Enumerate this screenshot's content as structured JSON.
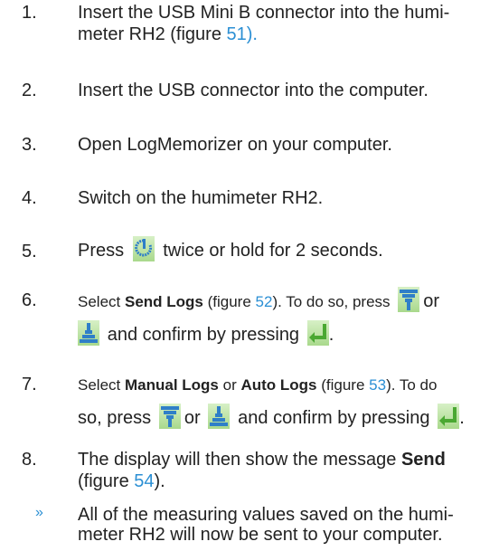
{
  "steps": [
    {
      "num": "1.",
      "text": "Insert the USB Mini B connector into the humi-",
      "text2": "meter RH2 (figure ",
      "fig": "51)."
    },
    {
      "num": "2.",
      "text": "Insert the USB connector into the computer."
    },
    {
      "num": "3.",
      "text": "Open LogMemorizer on your computer."
    },
    {
      "num": "4.",
      "text": "Switch on the humimeter RH2."
    },
    {
      "num": "5.",
      "pre": "Press",
      "post": "twice or hold for 2 seconds."
    },
    {
      "num": "6.",
      "a": "Select ",
      "bold": "Send Logs",
      "b": " (figure ",
      "fig": "52",
      "c": "). To do so, press",
      "d": "or",
      "e": "and confirm by pressing",
      "f": "."
    },
    {
      "num": "7.",
      "a": "Select ",
      "bold1": "Manual Logs",
      "or": " or ",
      "bold2": "Auto Logs",
      "b": " (figure ",
      "fig": "53",
      "c": "). To do",
      "so": "so, press",
      "d": "or",
      "e": "and confirm by pressing",
      "f": "."
    },
    {
      "num": "8.",
      "text": "The display will then show the message ",
      "bold": "Send",
      "text2": "(figure ",
      "fig": "54",
      "tail": ")."
    }
  ],
  "result": {
    "bullet": "»",
    "line1": "All of the measuring values saved on the humi-",
    "line2": "meter RH2 will now be sent to your computer."
  },
  "icons": {
    "power": "power-icon",
    "down": "arrow-down-icon",
    "up": "arrow-up-icon",
    "enter": "enter-icon"
  },
  "colors": {
    "link": "#2b8fd4",
    "icon_blue": "#2f7fc8",
    "icon_green": "#4aa832"
  }
}
